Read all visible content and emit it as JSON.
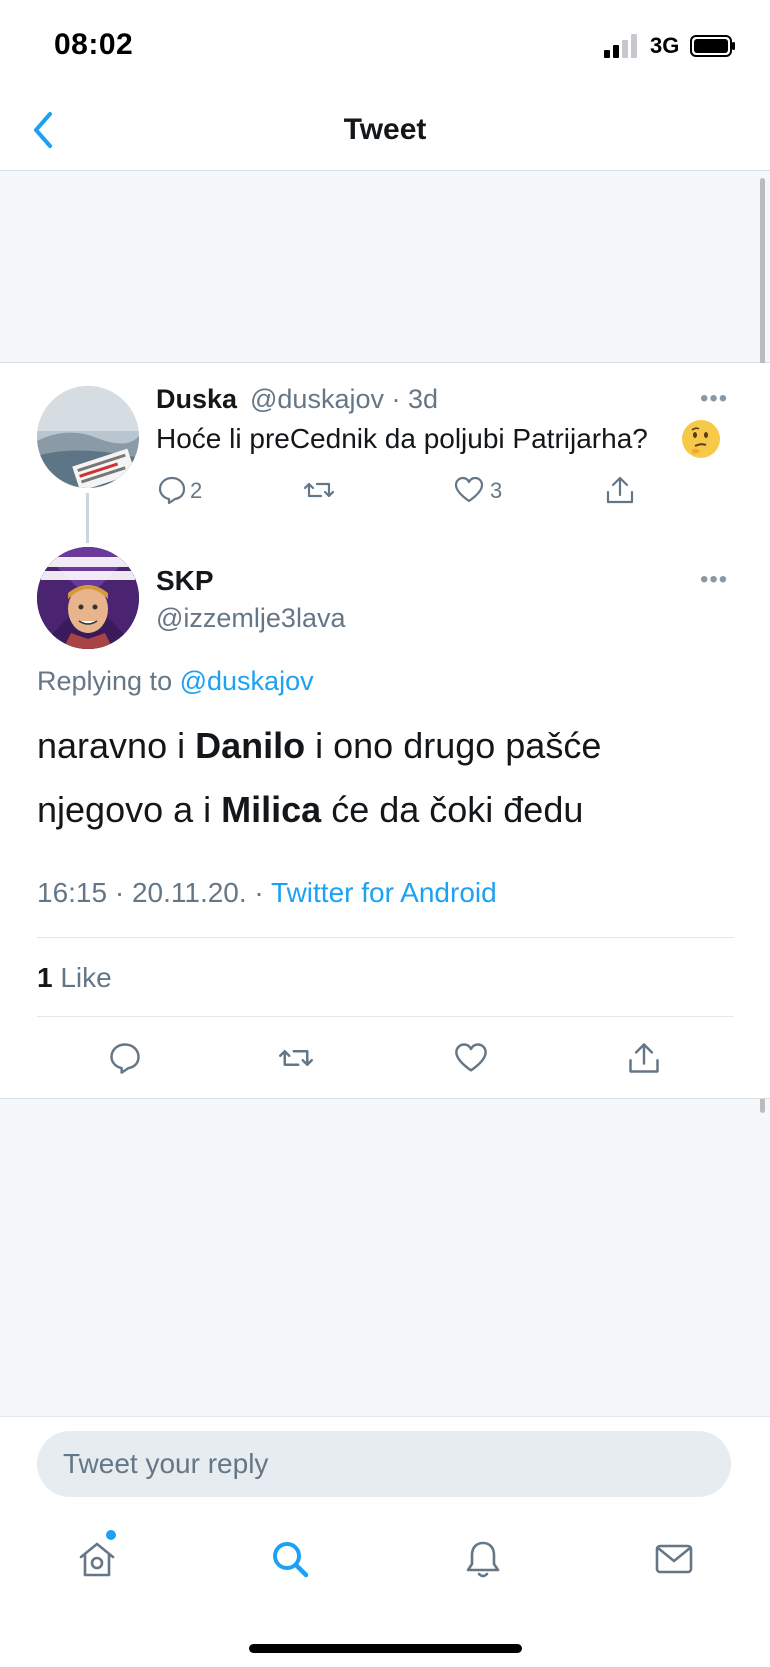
{
  "status_bar": {
    "time": "08:02",
    "network": "3G"
  },
  "nav": {
    "title": "Tweet",
    "back_icon": "chevron-left-icon"
  },
  "parent_tweet": {
    "name": "Duska",
    "handle_time": "@duskajov · 3d",
    "text": "Hoće li preCednik da poljubi Patrijarha?",
    "emoji": "thinking-face",
    "replies": "2",
    "retweets": "",
    "likes": "3"
  },
  "main_tweet": {
    "name": "SKP",
    "handle": "@izzemlje3lava",
    "replying_prefix": "Replying to",
    "replying_handle": "@duskajov",
    "text_parts": {
      "p1": "naravno i ",
      "b1": "Danilo",
      "p2": " i ono drugo pašće",
      "p3": "njegovo a i ",
      "b2": "Milica",
      "p4": " će da čoki đedu"
    },
    "timestamp": "16:15 · 20.11.20. · ",
    "source": "Twitter for Android",
    "like_count": "1",
    "like_label": " Like"
  },
  "reply": {
    "placeholder": "Tweet your reply"
  },
  "tabs": [
    "home-icon",
    "search-icon",
    "notifications-icon",
    "messages-icon"
  ],
  "colors": {
    "accent": "#1da1f2",
    "muted": "#657786",
    "background": "#f5f8fa"
  }
}
